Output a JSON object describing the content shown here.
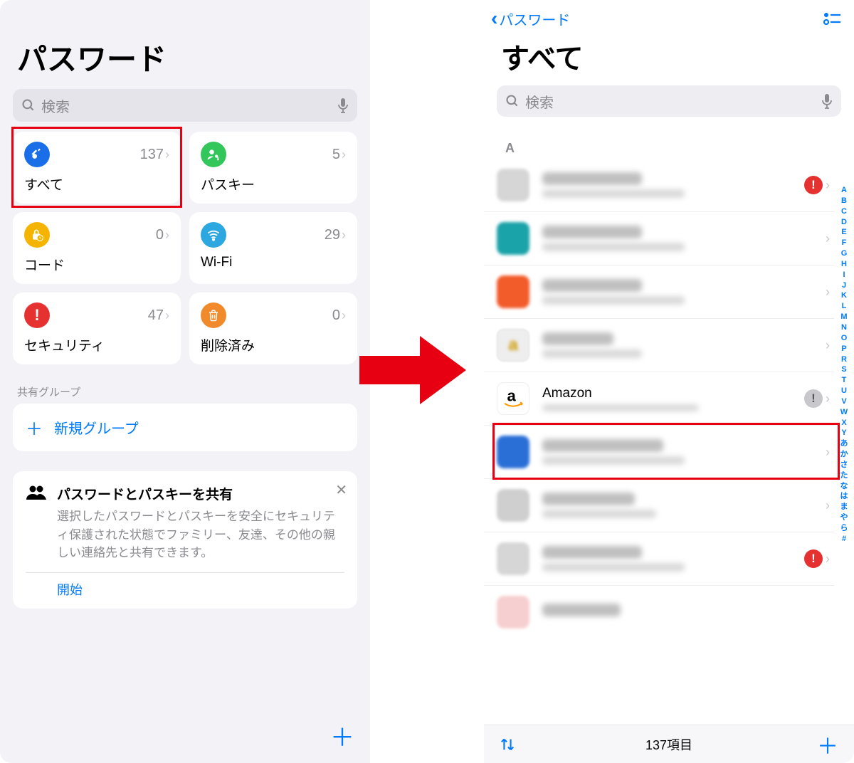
{
  "left": {
    "title": "パスワード",
    "search_placeholder": "検索",
    "tiles": {
      "all": {
        "label": "すべて",
        "count": "137",
        "color": "#1a6fe8"
      },
      "passkey": {
        "label": "パスキー",
        "count": "5",
        "color": "#32c65b"
      },
      "codes": {
        "label": "コード",
        "count": "0",
        "color": "#f5b400"
      },
      "wifi": {
        "label": "Wi-Fi",
        "count": "29",
        "color": "#2da7e0"
      },
      "security": {
        "label": "セキュリティ",
        "count": "47",
        "color": "#e63131"
      },
      "deleted": {
        "label": "削除済み",
        "count": "0",
        "color": "#f08a2a"
      }
    },
    "shared_section": "共有グループ",
    "new_group": "新規グループ",
    "share_card": {
      "title": "パスワードとパスキーを共有",
      "body": "選択したパスワードとパスキーを安全にセキュリティ保護された状態でファミリー、友達、その他の親しい連絡先と共有できます。",
      "start": "開始"
    }
  },
  "right": {
    "back_label": "パスワード",
    "title": "すべて",
    "search_placeholder": "検索",
    "section_letter": "A",
    "amazon_label": "Amazon",
    "index_letters": [
      "A",
      "B",
      "C",
      "D",
      "E",
      "F",
      "G",
      "H",
      "I",
      "J",
      "K",
      "L",
      "M",
      "N",
      "O",
      "P",
      "R",
      "S",
      "T",
      "U",
      "V",
      "W",
      "X",
      "Y",
      "あ",
      "か",
      "さ",
      "た",
      "な",
      "は",
      "ま",
      "や",
      "ら",
      "#"
    ],
    "bottom_count": "137項目"
  }
}
